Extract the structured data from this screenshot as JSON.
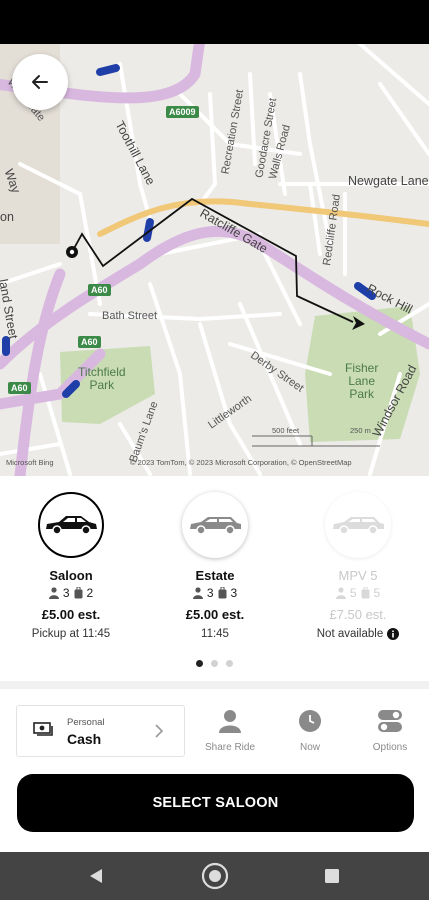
{
  "map": {
    "streets": {
      "west_gate": "West Gate",
      "toothill_lane": "Toothill Lane",
      "recreation_street": "Recreation Street",
      "goodacre_street": "Goodacre Street",
      "walls_road": "Walls Road",
      "newgate_lane": "Newgate Lane",
      "ratcliffe_gate": "Ratcliffe Gate",
      "redcliffe_road": "Redcliffe Road",
      "rock_hill": "Rock Hill",
      "bath_street": "Bath Street",
      "derby_street": "Derby Street",
      "littleworth": "Littleworth",
      "baums_lane": "Baum's Lane",
      "windsor_road": "Windsor Road",
      "way": "Way",
      "land_street": "land Street",
      "on": "on"
    },
    "parks": {
      "titchfield": "Titchfield\nPark",
      "fisher_lane": "Fisher\nLane\nPark"
    },
    "roads": {
      "a6009": "A6009",
      "a60_1": "A60",
      "a60_2": "A60",
      "a60_3": "A60"
    },
    "attribution": "Microsoft Bing",
    "copyright": "© 2023 TomTom, © 2023 Microsoft Corporation, © OpenStreetMap",
    "scale_ft": "500 feet",
    "scale_m": "250 m"
  },
  "rides": [
    {
      "name": "Saloon",
      "passengers": "3",
      "bags": "2",
      "price": "£5.00 est.",
      "note": "Pickup at 11:45"
    },
    {
      "name": "Estate",
      "passengers": "3",
      "bags": "3",
      "price": "£5.00 est.",
      "note": "11:45"
    },
    {
      "name": "MPV 5",
      "passengers": "5",
      "bags": "5",
      "price": "£7.50 est.",
      "note": "Not available"
    }
  ],
  "payment": {
    "type": "Personal",
    "method": "Cash"
  },
  "options": {
    "share_ride": "Share Ride",
    "now": "Now",
    "options": "Options"
  },
  "cta": {
    "label": "SELECT SALOON"
  },
  "colors": {
    "accent": "#000000",
    "route": "#1a1a1a",
    "main_road": "#d9b8e0",
    "park": "#c9dcb3",
    "traffic": "#1f3ea8"
  },
  "icons": {
    "back": "arrow-left-icon",
    "cash": "cash-icon",
    "person": "person-icon",
    "clock": "clock-icon",
    "toggles": "toggles-icon",
    "info": "info-icon"
  }
}
